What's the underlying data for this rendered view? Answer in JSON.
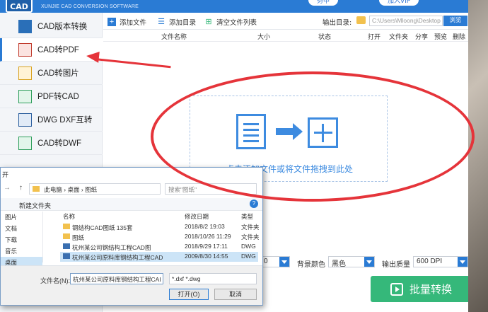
{
  "app": {
    "logo_text": "CAD",
    "subtitle": "XUNJIE CAD CONVERSION SOFTWARE",
    "top_buttons": [
      "务中",
      "加入VIP"
    ]
  },
  "sidebar": {
    "items": [
      {
        "label": "CAD版本转换",
        "icon": "cad-version-icon"
      },
      {
        "label": "CAD转PDF",
        "icon": "cad-to-pdf-icon",
        "active": true
      },
      {
        "label": "CAD转图片",
        "icon": "cad-to-image-icon"
      },
      {
        "label": "PDF转CAD",
        "icon": "pdf-to-cad-icon"
      },
      {
        "label": "DWG DXF互转",
        "icon": "dwg-dxf-icon"
      },
      {
        "label": "CAD转DWF",
        "icon": "cad-to-dwf-icon"
      }
    ]
  },
  "toolbar": {
    "add_file": "添加文件",
    "add_dir": "添加目录",
    "clear_list": "清空文件列表",
    "output_label": "输出目录:",
    "output_path": "C:\\Users\\Mloong\\Desktop",
    "browse": "浏览"
  },
  "columns": [
    "文件名称",
    "大小",
    "状态",
    "打开",
    "文件夹",
    "分享",
    "预览",
    "删除"
  ],
  "dropzone": {
    "text": "点击添加文件或将文件拖拽到此处"
  },
  "bottombar": {
    "first_value": "0",
    "bg_label": "背景颜色",
    "bg_value": "黑色",
    "quality_label": "输出质量",
    "quality_value": "600 DPI"
  },
  "convert_button": "批量转换",
  "dialog": {
    "title": "开",
    "path": [
      "此电脑",
      "桌面",
      "图纸"
    ],
    "search_placeholder": "搜索\"图纸\"",
    "new_folder": "新建文件夹",
    "left_items": [
      "图片",
      "文档",
      "下载",
      "音乐",
      "桌面"
    ],
    "headers": {
      "name": "名称",
      "modified": "修改日期",
      "type": "类型"
    },
    "files": [
      {
        "name": "钢结构CAD图纸 135套",
        "date": "2018/8/2 19:03",
        "type": "文件夹"
      },
      {
        "name": "图纸",
        "date": "2018/10/26 11:29",
        "type": "文件夹"
      },
      {
        "name": "杭州某公司钢结构工程CAD图",
        "date": "2018/9/29 17:11",
        "type": "DWG"
      },
      {
        "name": "杭州某公司原料库钢结构工程CAD",
        "date": "2009/8/30 14:55",
        "type": "DWG"
      }
    ],
    "filename_label": "文件名(N):",
    "filename_value": "杭州某公司原料库钢结构工程CAI",
    "filter_value": "*.dxf *.dwg",
    "open_button": "打开(O)",
    "cancel_button": "取消"
  },
  "colors": {
    "accent": "#2a7bd4",
    "convert": "#35b87a",
    "annotation": "#e5343a"
  }
}
